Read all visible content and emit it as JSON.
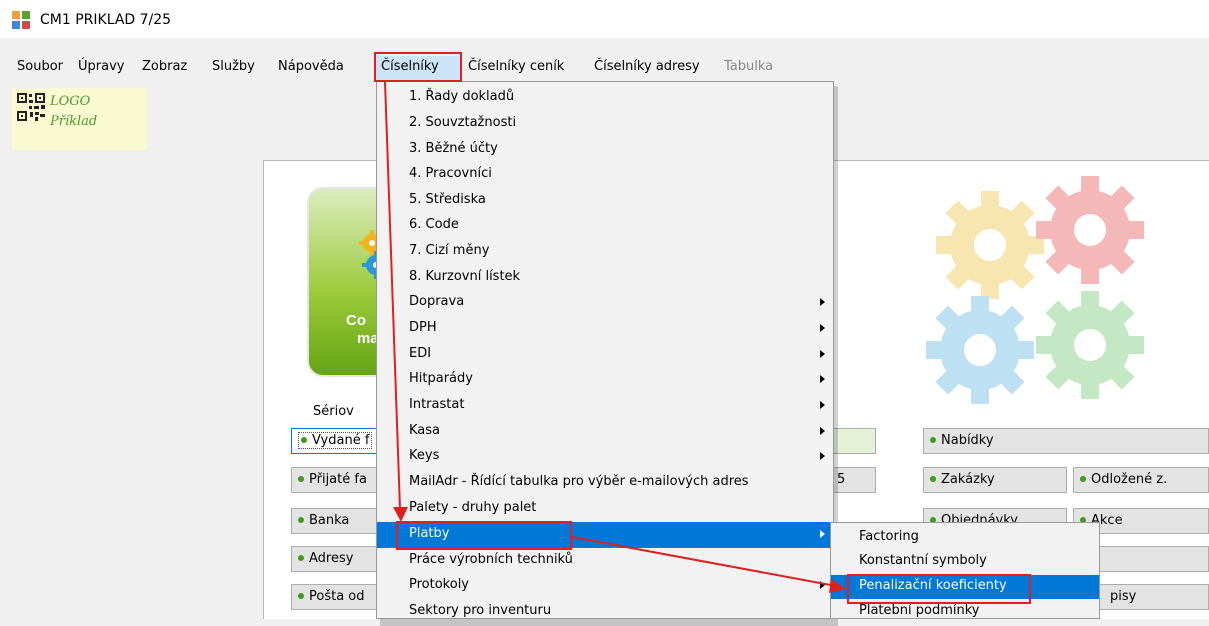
{
  "window": {
    "title": "CM1 PRIKLAD 7/25"
  },
  "menubar": {
    "items": [
      {
        "label": "Soubor"
      },
      {
        "label": "Úpravy"
      },
      {
        "label": "Zobraz"
      },
      {
        "label": "Služby"
      },
      {
        "label": "Nápověda"
      },
      {
        "label": "Číselníky",
        "active": true
      },
      {
        "label": "Číselníky ceník"
      },
      {
        "label": "Číselníky adresy"
      },
      {
        "label": "Tabulka",
        "disabled": true
      }
    ]
  },
  "logo": {
    "line1": "LOGO",
    "line2": "Příklad"
  },
  "panel": {
    "tile_text_1": "Co",
    "tile_text_2": "ma",
    "section_label": "Sériov",
    "buttons": [
      {
        "label": "Vydané f"
      },
      {
        "label": "Přijaté fa"
      },
      {
        "label": "Banka"
      },
      {
        "label": "Adresy"
      },
      {
        "label": "Pošta od"
      },
      {
        "label": "Nabídky"
      },
      {
        "label": "Zakázky"
      },
      {
        "label": "Odložené z."
      },
      {
        "label": "Objednávky"
      },
      {
        "label": "Akce"
      },
      {
        "label": "pisy"
      },
      {
        "label": "5"
      }
    ]
  },
  "dropdown": {
    "items": [
      {
        "label": "1. Řady dokladů"
      },
      {
        "label": "2. Souvztažnosti"
      },
      {
        "label": "3. Běžné účty"
      },
      {
        "label": "4. Pracovníci"
      },
      {
        "label": "5. Střediska"
      },
      {
        "label": "6. Code"
      },
      {
        "label": "7. Cizí měny"
      },
      {
        "label": "8. Kurzovní lístek"
      },
      {
        "label": "Doprava",
        "submenu": true
      },
      {
        "label": "DPH",
        "submenu": true
      },
      {
        "label": "EDI",
        "submenu": true
      },
      {
        "label": "Hitparády",
        "submenu": true
      },
      {
        "label": "Intrastat",
        "submenu": true
      },
      {
        "label": "Kasa",
        "submenu": true
      },
      {
        "label": "Keys",
        "submenu": true
      },
      {
        "label": "MailAdr - Řídící tabulka pro výběr e-mailových adres"
      },
      {
        "label": "Palety - druhy palet"
      },
      {
        "label": "Platby",
        "submenu": true,
        "highlighted": true
      },
      {
        "label": "Práce výrobních techniků"
      },
      {
        "label": "Protokoly",
        "submenu": true
      },
      {
        "label": "Sektory pro inventuru"
      }
    ]
  },
  "submenu": {
    "items": [
      {
        "label": "Factoring"
      },
      {
        "label": "Konstantní symboly"
      },
      {
        "label": "Penalizační koeficienty",
        "highlighted": true
      },
      {
        "label": "Platební podmínky"
      }
    ]
  },
  "colors": {
    "highlight": "#0078d7",
    "annotation": "#e02020",
    "accent_green": "#3e9a1a"
  }
}
